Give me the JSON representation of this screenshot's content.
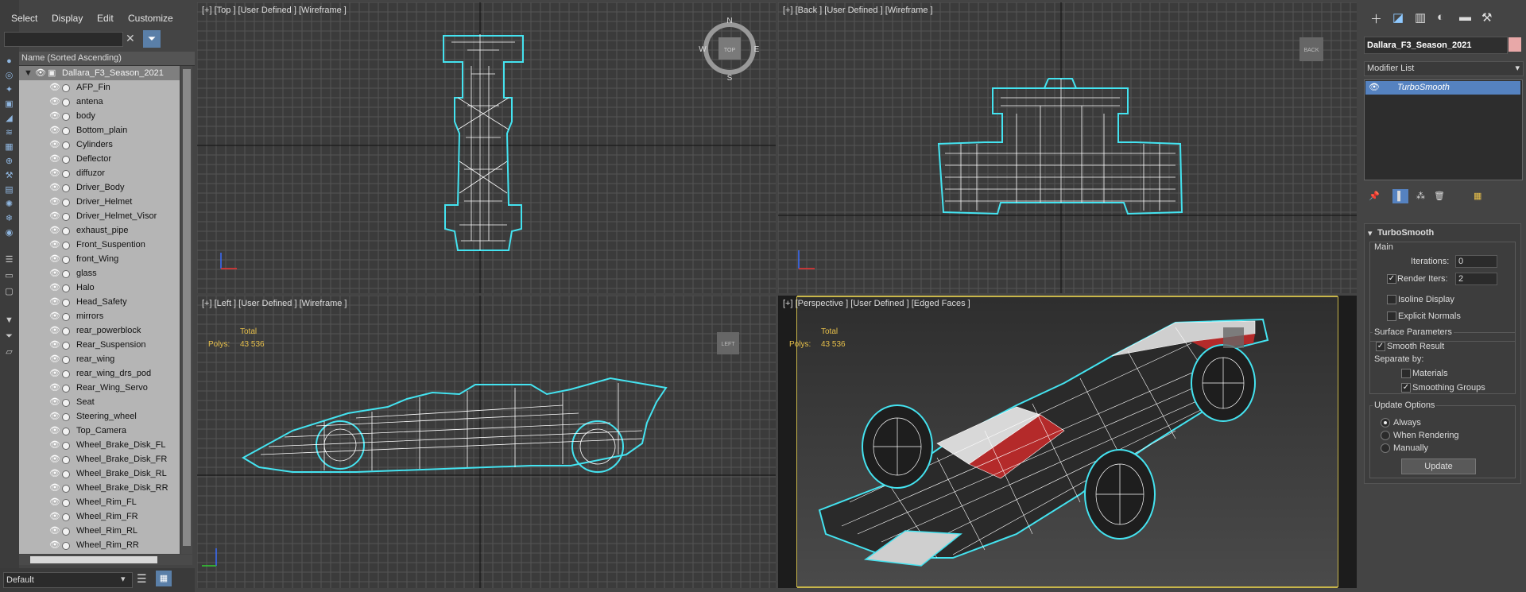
{
  "menu": {
    "select": "Select",
    "display": "Display",
    "edit": "Edit",
    "customize": "Customize"
  },
  "explorer": {
    "column_header": "Name (Sorted Ascending)",
    "root": "Dallara_F3_Season_2021",
    "items": [
      "AFP_Fin",
      "antena",
      "body",
      "Bottom_plain",
      "Cylinders",
      "Deflector",
      "diffuzor",
      "Driver_Body",
      "Driver_Helmet",
      "Driver_Helmet_Visor",
      "exhaust_pipe",
      "Front_Suspention",
      "front_Wing",
      "glass",
      "Halo",
      "Head_Safety",
      "mirrors",
      "rear_powerblock",
      "Rear_Suspension",
      "rear_wing",
      "rear_wing_drs_pod",
      "Rear_Wing_Servo",
      "Seat",
      "Steering_wheel",
      "Top_Camera",
      "Wheel_Brake_Disk_FL",
      "Wheel_Brake_Disk_FR",
      "Wheel_Brake_Disk_RL",
      "Wheel_Brake_Disk_RR",
      "Wheel_Rim_FL",
      "Wheel_Rim_FR",
      "Wheel_Rim_RL",
      "Wheel_Rim_RR"
    ],
    "layer": "Default"
  },
  "viewports": {
    "top": {
      "label": "[+] [Top ] [User Defined ] [Wireframe ]",
      "cube": "TOP"
    },
    "back": {
      "label": "[+] [Back ] [User Defined ] [Wireframe ]",
      "cube": "BACK"
    },
    "left": {
      "label": "[+] [Left ] [User Defined ] [Wireframe ]",
      "cube": "LEFT",
      "total": "Total",
      "polys_label": "Polys:",
      "polys": "43 536"
    },
    "persp": {
      "label": "[+] [Perspective ] [User Defined ] [Edged Faces ]",
      "total": "Total",
      "polys_label": "Polys:",
      "polys": "43 536"
    },
    "compass": {
      "n": "N",
      "s": "S",
      "e": "E",
      "w": "W"
    }
  },
  "command_panel": {
    "object_name": "Dallara_F3_Season_2021",
    "object_color": "#e8a8a8",
    "modifier_list": "Modifier List",
    "stack_item": "TurboSmooth",
    "rollout": {
      "title": "TurboSmooth",
      "main": "Main",
      "iterations_label": "Iterations:",
      "iterations": "0",
      "render_iters_label": "Render Iters:",
      "render_iters": "2",
      "isoline": "Isoline Display",
      "explicit": "Explicit Normals",
      "surface": "Surface Parameters",
      "smooth_result": "Smooth Result",
      "separate_by": "Separate by:",
      "materials": "Materials",
      "smoothing_groups": "Smoothing Groups",
      "update_options": "Update Options",
      "always": "Always",
      "when_rendering": "When Rendering",
      "manually": "Manually",
      "update": "Update"
    }
  },
  "colors": {
    "wire": "#44e3f0",
    "selected_border": "#c8b64a",
    "grid": "#5a5a5a",
    "bg": "#3b3b3b"
  }
}
